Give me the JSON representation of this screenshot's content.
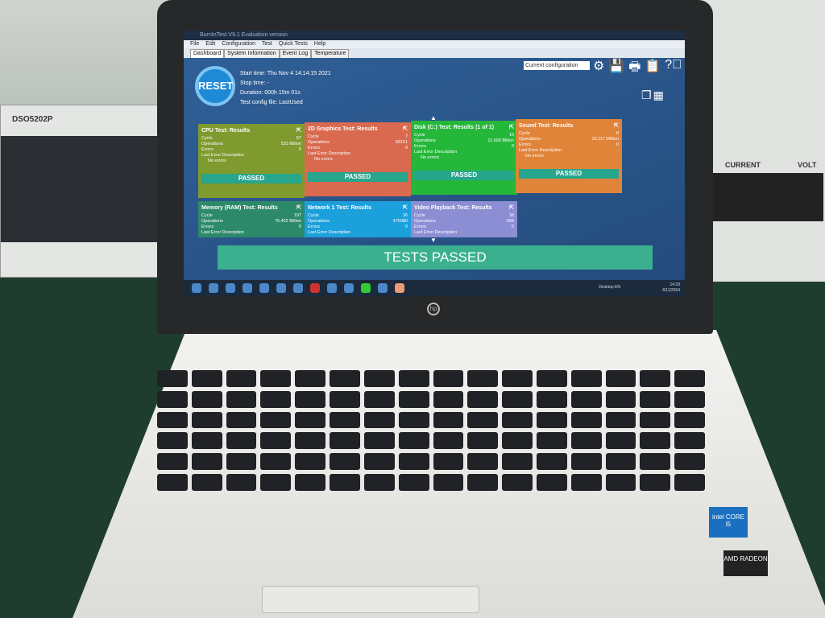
{
  "window": {
    "title": "BurnInTest V9.1 Evaluation version"
  },
  "menu": [
    "File",
    "Edit",
    "Configuration",
    "Test",
    "Quick Tests",
    "Help"
  ],
  "tabs": [
    "Dashboard",
    "System Information",
    "Event Log",
    "Temperature"
  ],
  "dashboard": {
    "reset_label": "RESET",
    "start_time": "Start time: Thu Nov  4 14:14:15 2021",
    "stop_time": "Stop time: -",
    "duration": "Duration: 000h 15m 01s",
    "config_file": "Test config file: LastUsed",
    "config_select": "Current configuration",
    "icons": [
      "gear-icon",
      "save-icon",
      "print-icon",
      "clipboard-icon",
      "help-icon"
    ],
    "labels": {
      "cycle": "Cycle",
      "operations": "Operations",
      "errors": "Errors",
      "last_error": "Last Error Description"
    },
    "cards": [
      {
        "title": "CPU Test: Results",
        "color": "#7f9a2e",
        "cycle": "57",
        "operations": "533 Billion",
        "errors": "0",
        "last_error": "No errors",
        "status": "PASSED"
      },
      {
        "title": "2D Graphics Test: Results",
        "color": "#d9694f",
        "cycle": "7",
        "operations": "59151",
        "errors": "0",
        "last_error": "No errors",
        "status": "PASSED"
      },
      {
        "title": "Disk (C:) Test: Results (1 of 1)",
        "color": "#24b73a",
        "cycle": "10",
        "operations": "11.606 Billion",
        "errors": "0",
        "last_error": "No errors",
        "status": "PASSED"
      },
      {
        "title": "Sound Test: Results",
        "color": "#e0843a",
        "cycle": "8",
        "operations": "19.117 Million",
        "errors": "0",
        "last_error": "No errors",
        "status": "PASSED"
      },
      {
        "title": "Memory (RAM) Test: Results",
        "color": "#2c8a6a",
        "cycle": "197",
        "operations": "75.402 Billion",
        "errors": "0",
        "last_error": ""
      },
      {
        "title": "Network 1 Test: Results",
        "color": "#1ba0dc",
        "cycle": "16",
        "operations": "476080",
        "errors": "0",
        "last_error": ""
      },
      {
        "title": "Video Playback Test: Results",
        "color": "#8c8ed4",
        "cycle": "38",
        "operations": "556",
        "errors": "0",
        "last_error": ""
      }
    ],
    "banner": "TESTS PASSED"
  },
  "taskbar": {
    "desktop": "Desktop",
    "lang": "EN",
    "time": "14:29",
    "date": "4/11/2564"
  },
  "hardware": {
    "scope_label": "DSO5202P",
    "psu_current": "CURRENT",
    "psu_volt": "VOLT",
    "brand": "hp",
    "intel": "intel CORE i5",
    "amd": "AMD RADEON"
  }
}
